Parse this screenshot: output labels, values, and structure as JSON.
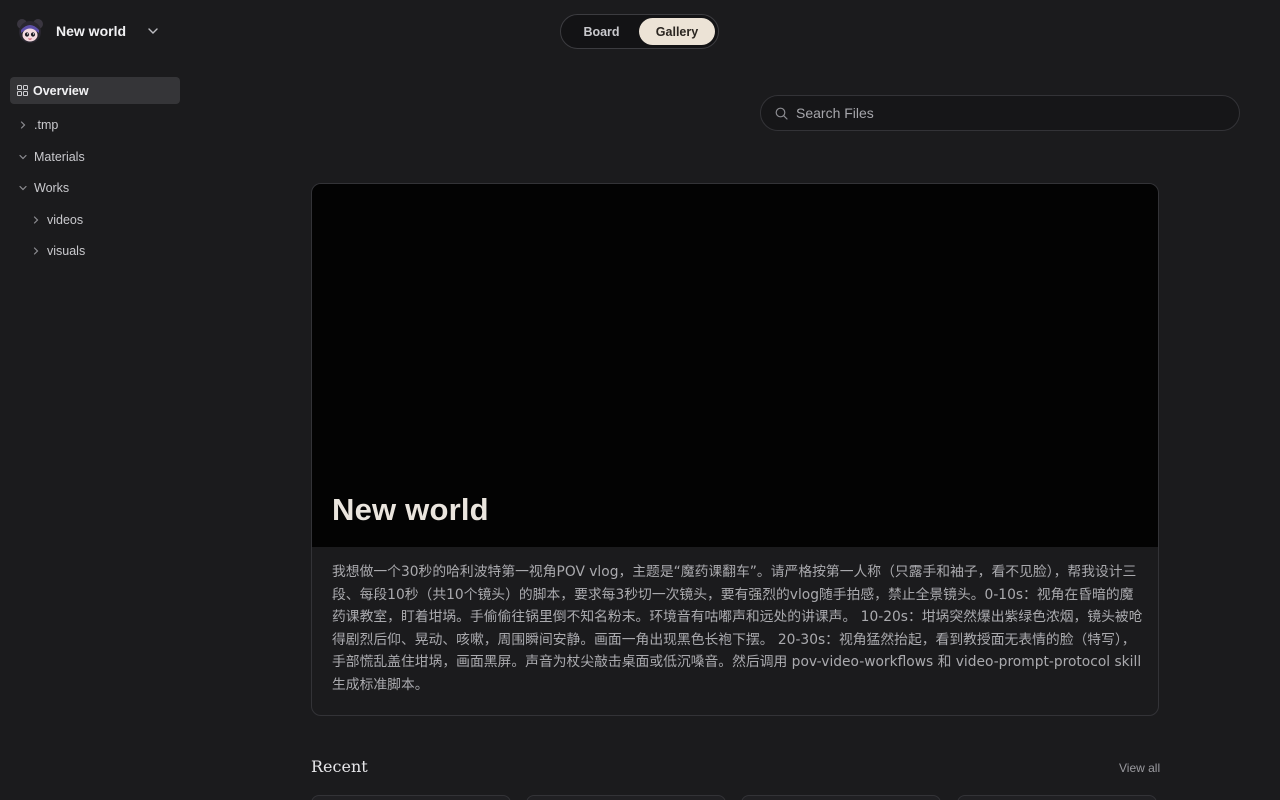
{
  "workspace": {
    "name": "New world"
  },
  "view_toggle": {
    "board_label": "Board",
    "gallery_label": "Gallery",
    "active": "Gallery"
  },
  "sidebar": {
    "overview_label": "Overview",
    "tree": [
      {
        "label": ".tmp",
        "expanded": false,
        "depth": 0
      },
      {
        "label": "Materials",
        "expanded": true,
        "depth": 0
      },
      {
        "label": "Works",
        "expanded": true,
        "depth": 0
      },
      {
        "label": "videos",
        "expanded": false,
        "depth": 1
      },
      {
        "label": "visuals",
        "expanded": false,
        "depth": 1
      }
    ]
  },
  "search": {
    "placeholder": "Search Files",
    "value": ""
  },
  "hero": {
    "title": "New world",
    "description": "我想做一个30秒的哈利波特第一视角POV vlog，主题是“魔药课翻车”。请严格按第一人称（只露手和袖子，看不见脸），帮我设计三段、每段10秒（共10个镜头）的脚本，要求每3秒切一次镜头，要有强烈的vlog随手拍感，禁止全景镜头。0-10s：视角在昏暗的魔药课教室，盯着坩埚。手偷偷往锅里倒不知名粉末。环境音有咕嘟声和远处的讲课声。 10-20s：坩埚突然爆出紫绿色浓烟，镜头被呛得剧烈后仰、晃动、咳嗽，周围瞬间安静。画面一角出现黑色长袍下摆。 20-30s：视角猛然抬起，看到教授面无表情的脸（特写），手部慌乱盖住坩埚，画面黑屏。声音为杖尖敲击桌面或低沉嗓音。然后调用 pov-video-workflows 和 video-prompt-protocol skill 生成标准脚本。"
  },
  "recent": {
    "title": "Recent",
    "view_all_label": "View all"
  },
  "colors": {
    "background": "#1b1b1d",
    "accent_toggle": "#ece3d6",
    "hero_media": "#030303"
  }
}
